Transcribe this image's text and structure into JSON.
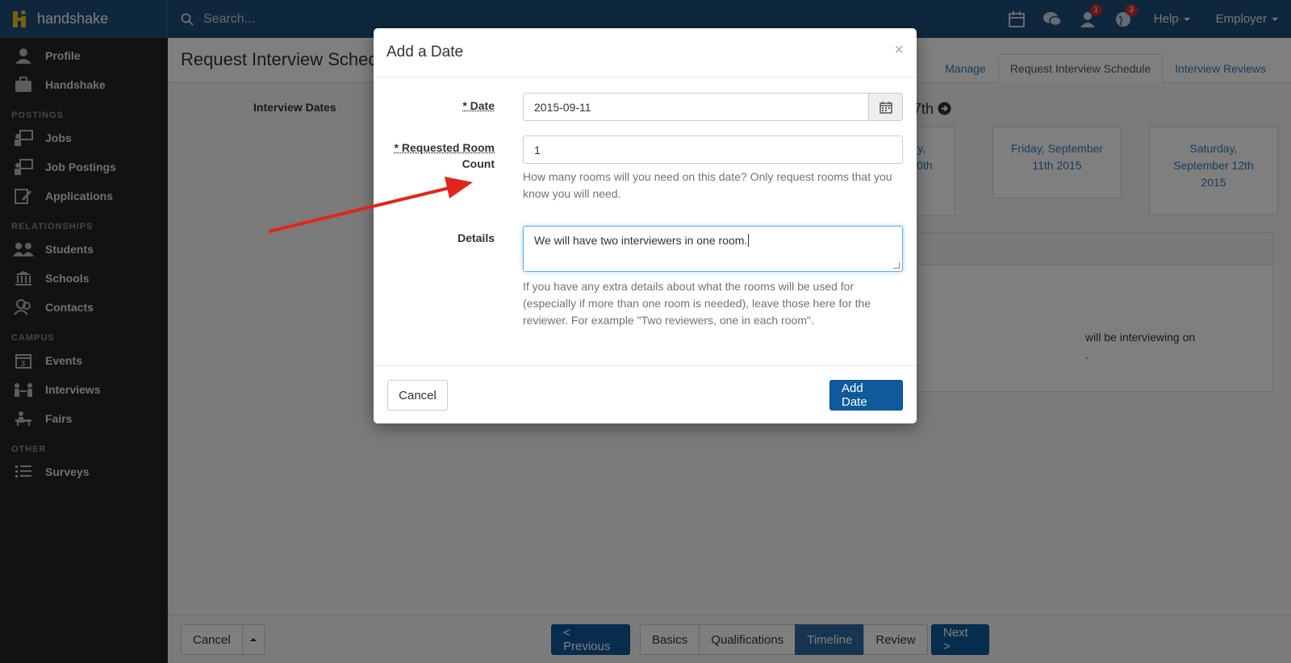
{
  "topbar": {
    "brand": "handshake",
    "search_placeholder": "Search...",
    "notifications_badge": "1",
    "alerts_badge": "3",
    "help_label": "Help",
    "account_label": "Employer"
  },
  "sidebar": {
    "top_items": [
      {
        "label": "Profile",
        "icon": "user-icon"
      },
      {
        "label": "Handshake",
        "icon": "briefcase-icon"
      }
    ],
    "sections": [
      {
        "title": "POSTINGS",
        "items": [
          {
            "label": "Jobs",
            "icon": "presenter-icon"
          },
          {
            "label": "Job Postings",
            "icon": "presenter-icon"
          },
          {
            "label": "Applications",
            "icon": "edit-icon"
          }
        ]
      },
      {
        "title": "RELATIONSHIPS",
        "items": [
          {
            "label": "Students",
            "icon": "group-icon"
          },
          {
            "label": "Schools",
            "icon": "institution-icon"
          },
          {
            "label": "Contacts",
            "icon": "contacts-icon"
          }
        ]
      },
      {
        "title": "CAMPUS",
        "items": [
          {
            "label": "Events",
            "icon": "calendar-icon"
          },
          {
            "label": "Interviews",
            "icon": "interview-icon"
          },
          {
            "label": "Fairs",
            "icon": "booth-icon"
          }
        ]
      },
      {
        "title": "OTHER",
        "items": [
          {
            "label": "Surveys",
            "icon": "list-icon"
          }
        ]
      }
    ]
  },
  "main": {
    "page_title": "Request Interview Sched",
    "tabs": [
      "Manage",
      "Request Interview Schedule",
      "Interview Reviews"
    ],
    "section_label": "Interview Dates",
    "week_nav": "7th",
    "day_cards": [
      {
        "text": "y,\n10th"
      },
      {
        "text": "Friday, September\n11th 2015"
      },
      {
        "text": "Saturday,\nSeptember 12th\n2015"
      }
    ],
    "panel_text": "will be interviewing on\n."
  },
  "bottom_bar": {
    "cancel_label": "Cancel",
    "previous_label": "< Previous",
    "steps": [
      "Basics",
      "Qualifications",
      "Timeline",
      "Review"
    ],
    "active_step": "Timeline",
    "next_label": "Next >"
  },
  "modal": {
    "title": "Add a Date",
    "close": "×",
    "date_label": "* Date",
    "date_value": "2015-09-11",
    "room_label_line1": "* Requested Room",
    "room_label_line2": "Count",
    "room_value": "1",
    "room_help": "How many rooms will you need on this date? Only request rooms that you know you will need.",
    "details_label": "Details",
    "details_value": "We will have two interviewers in one room.",
    "details_help": "If you have any extra details about what the rooms will be used for (especially if more than one room is needed), leave those here for the reviewer. For example \"Two reviewers, one in each room\".",
    "cancel_label": "Cancel",
    "submit_label": "Add Date"
  },
  "colors": {
    "topbar": "#1f4e79",
    "sidebar": "#222426",
    "primary": "#0e5a9c",
    "annotation_arrow": "#e0261b"
  }
}
